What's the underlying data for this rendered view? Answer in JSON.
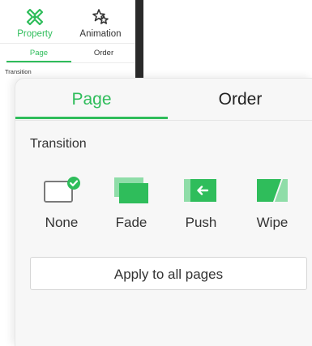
{
  "mini_panel": {
    "tabs": [
      {
        "label": "Property",
        "icon": "property-icon",
        "active": true
      },
      {
        "label": "Animation",
        "icon": "animation-icon",
        "active": false
      }
    ],
    "subtabs": [
      {
        "label": "Page",
        "active": true
      },
      {
        "label": "Order",
        "active": false
      }
    ],
    "section_title": "Transition"
  },
  "panel": {
    "tabs": [
      {
        "label": "Page",
        "active": true
      },
      {
        "label": "Order",
        "active": false
      }
    ],
    "section_title": "Transition",
    "transitions": [
      {
        "label": "None",
        "icon": "none-transition-icon",
        "selected": true
      },
      {
        "label": "Fade",
        "icon": "fade-transition-icon",
        "selected": false
      },
      {
        "label": "Push",
        "icon": "push-transition-icon",
        "selected": false
      },
      {
        "label": "Wipe",
        "icon": "wipe-transition-icon",
        "selected": false
      }
    ],
    "apply_button": "Apply to all pages"
  },
  "colors": {
    "accent": "#2fbd5b",
    "text": "#333333",
    "panel_bg": "#f7f7f7"
  }
}
